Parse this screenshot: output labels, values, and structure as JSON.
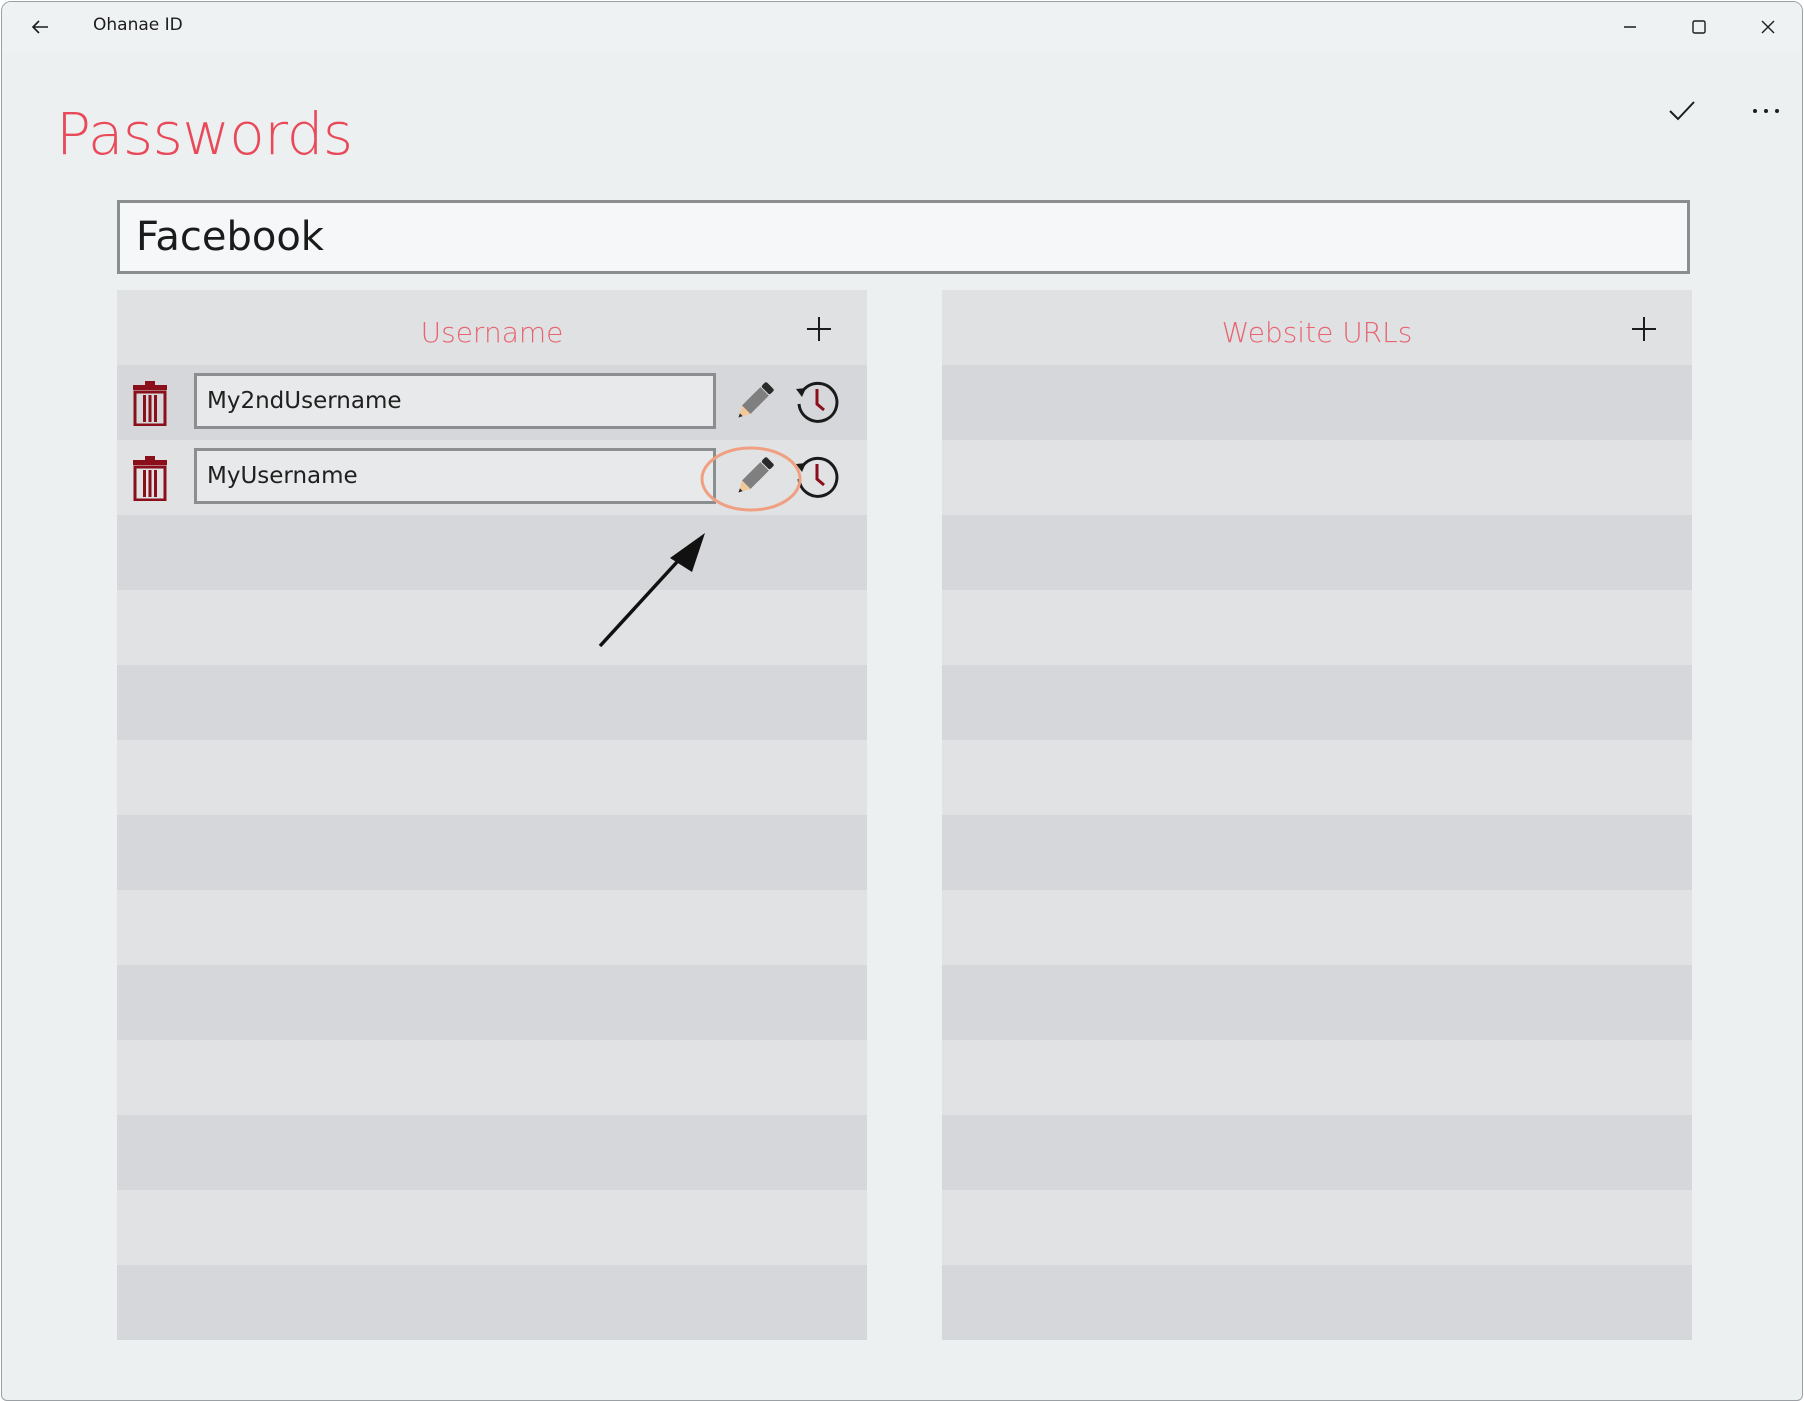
{
  "window": {
    "title": "Ohanae ID"
  },
  "page": {
    "title": "Passwords"
  },
  "entry": {
    "name": "Facebook"
  },
  "username_panel": {
    "title": "Username",
    "items": [
      {
        "value": "My2ndUsername"
      },
      {
        "value": "MyUsername"
      }
    ]
  },
  "urls_panel": {
    "title": "Website URLs",
    "items": []
  },
  "colors": {
    "accent": "#e84a5a",
    "delete": "#8b0f1b",
    "highlight": "#f0a080"
  },
  "icons": {
    "back": "back-arrow-icon",
    "accept": "checkmark-icon",
    "more": "more-ellipsis-icon",
    "add": "plus-icon",
    "delete": "trash-icon",
    "edit": "pencil-icon",
    "history": "history-clock-icon"
  }
}
